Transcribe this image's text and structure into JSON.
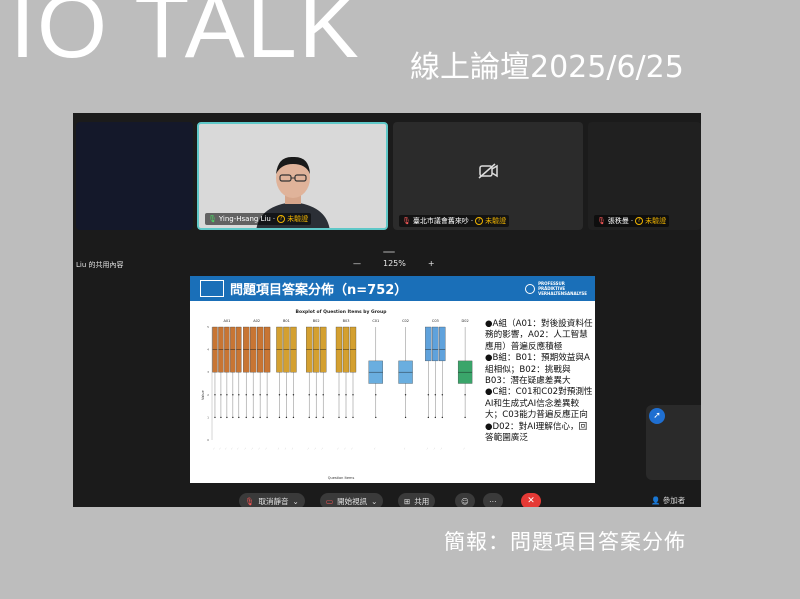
{
  "banner": {
    "title": "IO TALK",
    "subtitle": "線上論壇2025/6/25"
  },
  "caption": "簡報：問題項目答案分佈",
  "meeting": {
    "tiles": [
      {
        "name": "",
        "status": ""
      },
      {
        "name": "Ying-Hsang Liu",
        "status": "未驗證",
        "mic": "on",
        "camera": "on"
      },
      {
        "name": "臺北市議會舊來吵",
        "status": "未驗證",
        "mic": "off",
        "camera": "off"
      },
      {
        "name": "張秩曼",
        "status": "未驗證",
        "mic": "off",
        "camera": "off"
      }
    ],
    "share_title": "Liu 的共用內容",
    "zoom": {
      "minus": "—",
      "level": "125%",
      "plus": "+"
    },
    "controls": {
      "mute": "取消靜音",
      "video": "開始視訊",
      "share": "共用",
      "end": "✕",
      "participants": "參加者"
    },
    "icons": [
      "mic-icon",
      "camera-off-icon",
      "share-icon",
      "rocket-icon",
      "person-icon",
      "question-icon"
    ]
  },
  "slide": {
    "title": "問題項目答案分佈（n=752）",
    "logo_right": [
      "PROFESSUR",
      "PRÄDIKTIVE",
      "VERHALTENSANALYSE"
    ],
    "bullets": [
      "●A組（A01：對後設資料任務的影響，A02：人工智慧應用）普遍反應積極",
      "●B組：B01：預期效益與A組相似；B02：挑戰與B03：潛在疑慮差異大",
      "●C組：C01和C02對預測性AI和生成式AI信念差異較大；C03能力普遍反應正向",
      "●D02：對AI理解信心，回答範圍廣泛"
    ]
  },
  "chart_data": {
    "type": "box",
    "title": "Boxplot of Question Items by Group",
    "xlabel": "Question Items",
    "ylabel": "Value",
    "ylim": [
      0,
      5
    ],
    "groups": [
      "A01",
      "A02",
      "B01",
      "B02",
      "B03",
      "C01",
      "C02",
      "C03",
      "D02"
    ],
    "colors": {
      "A": "#c87533",
      "B": "#d4a030",
      "C1": "#6aaedf",
      "C3": "#5fa2dc",
      "D": "#3aa56a"
    },
    "series": [
      {
        "group": "A01",
        "count": 5,
        "q1": 3,
        "median": 4,
        "q3": 5,
        "min": 1,
        "max": 5
      },
      {
        "group": "A02",
        "count": 4,
        "q1": 3,
        "median": 4,
        "q3": 5,
        "min": 1,
        "max": 5
      },
      {
        "group": "B01",
        "count": 3,
        "q1": 3,
        "median": 4,
        "q3": 5,
        "min": 1,
        "max": 5
      },
      {
        "group": "B02",
        "count": 3,
        "q1": 3,
        "median": 4,
        "q3": 5,
        "min": 1,
        "max": 5
      },
      {
        "group": "B03",
        "count": 3,
        "q1": 3,
        "median": 4,
        "q3": 5,
        "min": 1,
        "max": 5
      },
      {
        "group": "C01",
        "count": 1,
        "q1": 2.5,
        "median": 3,
        "q3": 3.5,
        "min": 1,
        "max": 5
      },
      {
        "group": "C02",
        "count": 1,
        "q1": 2.5,
        "median": 3,
        "q3": 3.5,
        "min": 1,
        "max": 5
      },
      {
        "group": "C03",
        "count": 3,
        "q1": 3.5,
        "median": 4,
        "q3": 5,
        "min": 1,
        "max": 5
      },
      {
        "group": "D02",
        "count": 1,
        "q1": 2.5,
        "median": 3,
        "q3": 3.5,
        "min": 1,
        "max": 5
      }
    ]
  }
}
